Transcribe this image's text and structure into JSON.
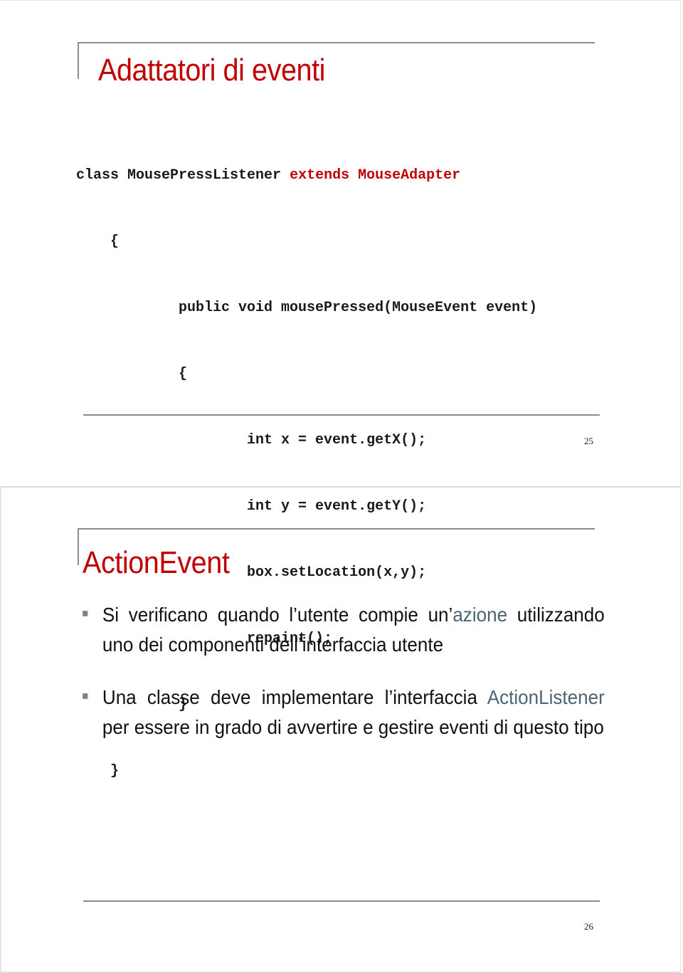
{
  "slides": [
    {
      "title": "Adattatori di eventi",
      "code": {
        "line1_a": "class MousePressListener ",
        "line1_kw": "extends MouseAdapter",
        "lines": [
          "    {",
          "            public void mousePressed(MouseEvent event)",
          "            {",
          "                    int x = event.getX();",
          "                    int y = event.getY();",
          "                    box.setLocation(x,y);",
          "                    repaint();",
          "            }",
          "    }"
        ]
      },
      "page_number": "25"
    },
    {
      "title": "ActionEvent",
      "bullets": [
        {
          "text_before": "Si verificano quando l’utente compie un’",
          "accent": "azione",
          "text_after": " utilizzando uno dei componenti dell’interfaccia utente"
        },
        {
          "text_before": "Una classe deve implementare l’interfaccia ",
          "accent": "ActionListener",
          "text_after": " per essere in grado di avvertire e gestire eventi di questo tipo"
        }
      ],
      "page_number": "26"
    }
  ],
  "colors": {
    "title": "#c00000",
    "accent": "#4d6475",
    "rule": "#8c8c8c",
    "bullet_marker": "#7f7f7f"
  }
}
